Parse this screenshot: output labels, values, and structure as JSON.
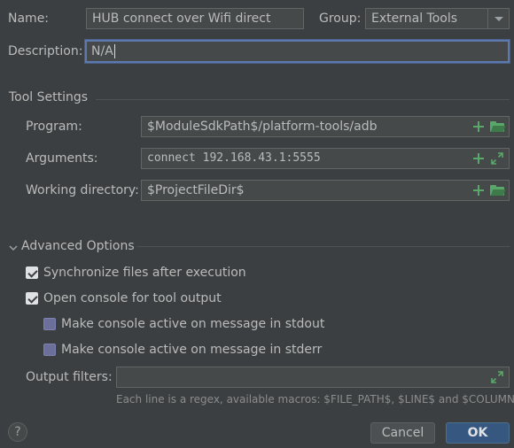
{
  "name": {
    "label": "Name:",
    "value": "HUB connect over Wifi direct"
  },
  "group": {
    "label": "Group:",
    "value": "External Tools"
  },
  "description": {
    "label": "Description:",
    "value": "N/A"
  },
  "tool_settings": {
    "title": "Tool Settings",
    "program": {
      "label": "Program:",
      "value": "$ModuleSdkPath$/platform-tools/adb"
    },
    "arguments": {
      "label": "Arguments:",
      "value": "connect 192.168.43.1:5555"
    },
    "working_directory": {
      "label": "Working directory:",
      "value": "$ProjectFileDir$"
    }
  },
  "advanced": {
    "title": "Advanced Options",
    "sync_files": {
      "label": "Synchronize files after execution",
      "checked": true
    },
    "open_console": {
      "label": "Open console for tool output",
      "checked": true
    },
    "console_stdout": {
      "label": "Make console active on message in stdout",
      "checked": false
    },
    "console_stderr": {
      "label": "Make console active on message in stderr",
      "checked": false
    },
    "output_filters": {
      "label": "Output filters:",
      "value": ""
    },
    "hint": "Each line is a regex, available macros: $FILE_PATH$, $LINE$ and $COLUMN$"
  },
  "buttons": {
    "help": "?",
    "cancel": "Cancel",
    "ok": "OK"
  },
  "colors": {
    "background": "#3c3f41",
    "accent": "#365880",
    "icon_green": "#59a869"
  }
}
